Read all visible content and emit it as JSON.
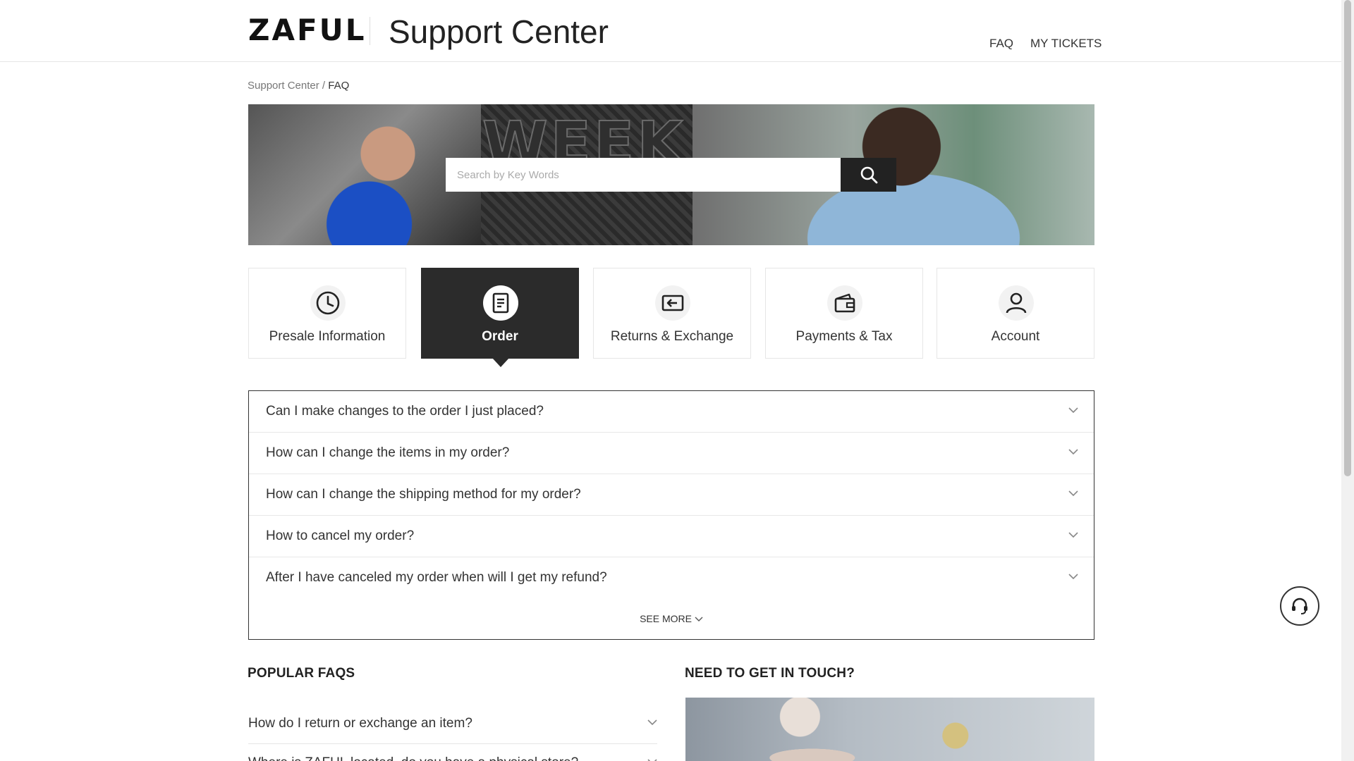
{
  "header": {
    "logo": "ZAFUL",
    "title": "Support Center",
    "nav": [
      {
        "label": "FAQ"
      },
      {
        "label": "MY TICKETS"
      }
    ]
  },
  "breadcrumb": {
    "root": "Support Center",
    "separator": " / ",
    "current": "FAQ"
  },
  "banner": {
    "overlay_text": "WEEK",
    "search": {
      "placeholder": "Search by Key Words",
      "value": ""
    },
    "search_button_icon": "search-icon"
  },
  "categories": [
    {
      "label": "Presale Information",
      "icon": "clock-icon",
      "active": false
    },
    {
      "label": "Order",
      "icon": "document-icon",
      "active": true
    },
    {
      "label": "Returns & Exchange",
      "icon": "return-icon",
      "active": false
    },
    {
      "label": "Payments & Tax",
      "icon": "wallet-icon",
      "active": false
    },
    {
      "label": "Account",
      "icon": "user-icon",
      "active": false
    }
  ],
  "faq": {
    "questions": [
      "Can I make changes to the order I just placed?",
      "How can I change the items in my order?",
      "How can I change the shipping method for my order?",
      "How to cancel my order?",
      "After I have canceled my order when will I get my refund?"
    ],
    "see_more": "SEE MORE"
  },
  "popular": {
    "title": "POPULAR FAQS",
    "questions": [
      "How do I return or exchange an item?",
      "Where is ZAFUL located, do you have a physical store?"
    ]
  },
  "contact": {
    "title": "NEED TO GET IN TOUCH?"
  },
  "chat_icon": "headset-icon",
  "colors": {
    "accent": "#2b2b2b",
    "border": "#e6e6e6",
    "text": "#333333"
  }
}
